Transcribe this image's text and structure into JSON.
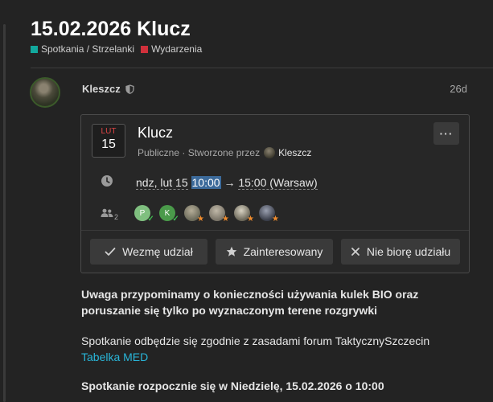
{
  "topic": {
    "title": "15.02.2026 Klucz",
    "categories": [
      {
        "label": "Spotkania / Strzelanki",
        "color": "#12a89d"
      },
      {
        "label": "Wydarzenia",
        "color": "#d0303b"
      }
    ]
  },
  "post": {
    "author": "Kleszcz",
    "age": "26d"
  },
  "event": {
    "month": "LUT",
    "day": "15",
    "title": "Klucz",
    "visibility_prefix": "Publiczne · Stworzone przez",
    "creator": "Kleszcz",
    "more_label": "···",
    "date_prefix": "ndz, lut 15",
    "start_time": "10:00",
    "arrow": "→",
    "end_time": "15:00 (Warsaw)",
    "attendee_count": "2",
    "attendees": [
      {
        "letter": "P",
        "color": "#7fbf7f",
        "status": "going"
      },
      {
        "letter": "K",
        "color": "#4a9a4a",
        "status": "going"
      },
      {
        "letter": "",
        "color": "#6b6a5a",
        "status": "interested"
      },
      {
        "letter": "",
        "color": "#7a7468",
        "status": "interested"
      },
      {
        "letter": "",
        "color": "#6a6658",
        "status": "interested"
      },
      {
        "letter": "",
        "color": "#4a4e5a",
        "status": "interested"
      }
    ],
    "buttons": {
      "going": "Wezmę udział",
      "interested": "Zainteresowany",
      "not_going": "Nie biorę udziału"
    }
  },
  "body": {
    "p1": "Uwaga przypominamy o konieczności używania kulek BIO oraz poruszanie się tylko po wyznaczonym terene rozgrywki",
    "p2": "Spotkanie odbędzie się zgodnie z zasadami forum TaktycznySzczecin",
    "link": "Tabelka MED",
    "p3": "Spotkanie rozpocznie się w Niedzielę, 15.02.2026 o 10:00"
  }
}
